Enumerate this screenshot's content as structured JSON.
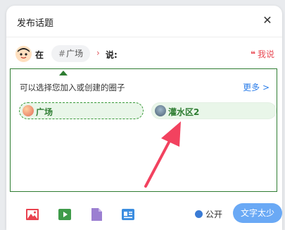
{
  "dialog": {
    "title": "发布话题",
    "close_icon": "close-icon"
  },
  "post_row": {
    "in_label": "在",
    "topic_chip": {
      "hash": "#",
      "label": "广场"
    },
    "say_label": "说:",
    "speak_quote": "❝",
    "speak_label": "我说"
  },
  "panel": {
    "hint": "可以选择您加入或创建的圈子",
    "more_label": "更多 >",
    "circles": [
      {
        "label": "广场"
      },
      {
        "label": "灌水区2"
      }
    ]
  },
  "toolbar": {
    "icons": [
      "image-icon",
      "video-icon",
      "document-icon",
      "card-icon"
    ],
    "visibility_label": "公开",
    "submit_label": "文字太少"
  },
  "colors": {
    "accent_green": "#2e7d32",
    "accent_red": "#e94b55",
    "link_blue": "#2b7de9",
    "button_blue": "#6aa9f5",
    "annotation_arrow": "#f2425f"
  }
}
